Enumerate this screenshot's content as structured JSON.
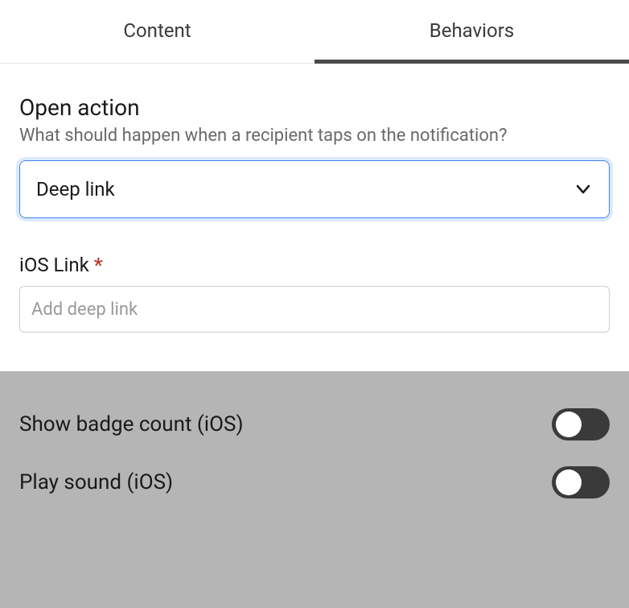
{
  "tabs": {
    "content": "Content",
    "behaviors": "Behaviors",
    "active": "behaviors"
  },
  "open_action": {
    "title": "Open action",
    "description": "What should happen when a recipient taps on the notification?",
    "selected": "Deep link"
  },
  "ios_link": {
    "label": "iOS Link",
    "required_marker": "*",
    "placeholder": "Add deep link",
    "value": ""
  },
  "options": {
    "badge": {
      "label": "Show badge count (iOS)",
      "on": false
    },
    "sound": {
      "label": "Play sound (iOS)",
      "on": false
    }
  }
}
